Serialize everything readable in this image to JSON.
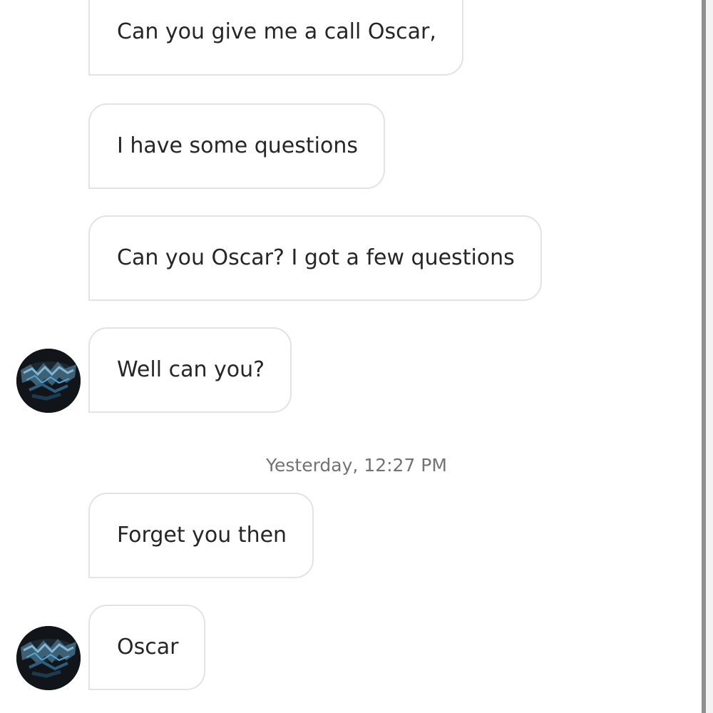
{
  "messages": [
    {
      "text": "Can you give me a call Oscar,"
    },
    {
      "text": "I have some questions"
    },
    {
      "text": "Can you Oscar? I got a few questions"
    },
    {
      "text": "Well can you?"
    },
    {
      "text": "Forget you then"
    },
    {
      "text": "Oscar"
    }
  ],
  "timestamp": "Yesterday, 12:27 PM",
  "avatar_icon": "profile-picture-dark-graffiti-logo",
  "colors": {
    "bubble_border": "#e3e3e3",
    "text": "#262626",
    "timestamp": "#737373",
    "scrollbar": "#8e8e8e"
  }
}
